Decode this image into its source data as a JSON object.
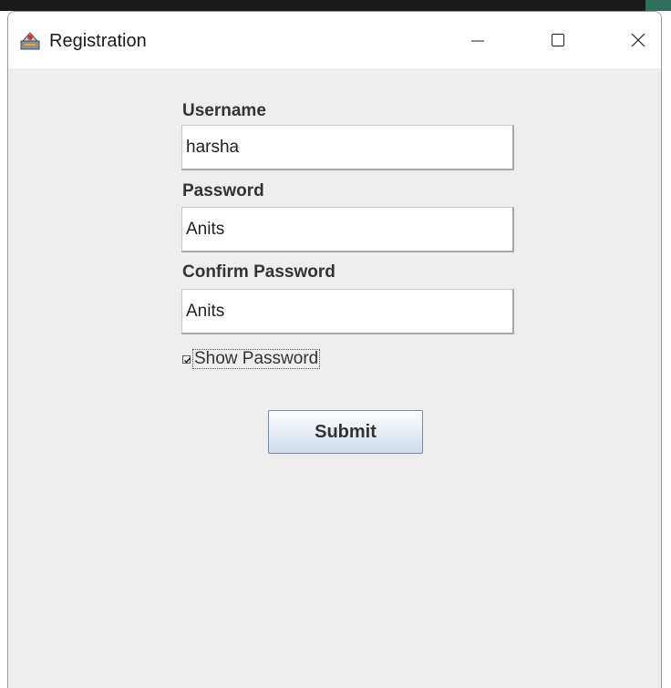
{
  "window": {
    "title": "Registration",
    "controls": {
      "minimize_icon": "minimize-icon",
      "maximize_icon": "maximize-icon",
      "close_icon": "close-icon"
    }
  },
  "form": {
    "username": {
      "label": "Username",
      "value": "harsha"
    },
    "password": {
      "label": "Password",
      "value": "Anits"
    },
    "confirm_password": {
      "label": "Confirm Password",
      "value": "Anits"
    },
    "show_password": {
      "label": "Show Password",
      "checked": true
    },
    "submit_label": "Submit"
  },
  "colors": {
    "window_background": "#eeeeee",
    "titlebar_background": "#ffffff",
    "field_background": "#ffffff",
    "label_text": "#333333"
  }
}
